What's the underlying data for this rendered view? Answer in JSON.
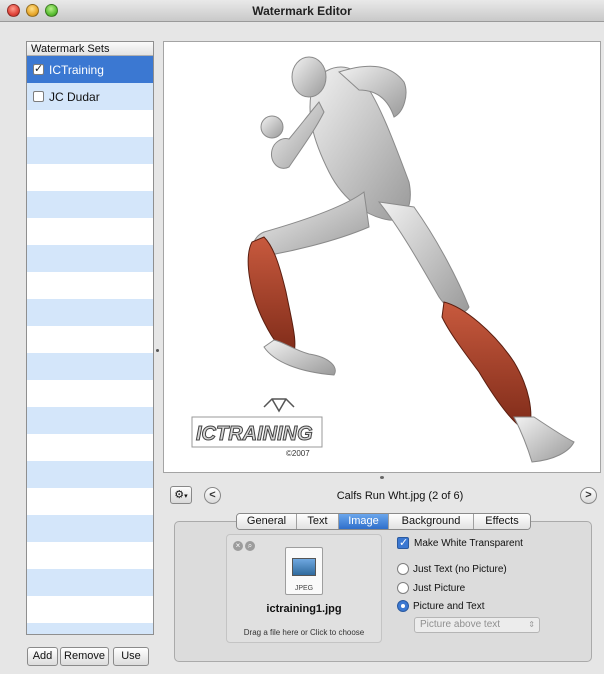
{
  "window": {
    "title": "Watermark Editor"
  },
  "sidebar": {
    "header": "Watermark Sets",
    "items": [
      {
        "label": "ICTraining",
        "checked": true,
        "selected": true
      },
      {
        "label": "JC Dudar",
        "checked": false,
        "selected": false
      }
    ]
  },
  "sidebar_buttons": {
    "add": "Add",
    "remove": "Remove",
    "use": "Use"
  },
  "preview": {
    "watermark_text": "ICTRAINING",
    "watermark_year": "©2007"
  },
  "nav": {
    "file_label": "Calfs Run Wht.jpg (2 of 6)",
    "prev_label": "<",
    "next_label": ">"
  },
  "tabs": [
    "General",
    "Text",
    "Image",
    "Background",
    "Effects"
  ],
  "active_tab": "Image",
  "image_tab": {
    "file_ext": "JPEG",
    "file_name": "ictraining1.jpg",
    "drop_hint": "Drag a file here or Click to choose",
    "make_white_transparent": "Make White Transparent",
    "radio_options": [
      "Just Text (no Picture)",
      "Just Picture",
      "Picture and Text"
    ],
    "selected_option": "Picture and Text",
    "position_select": "Picture above text"
  },
  "colors": {
    "selection": "#3b78d2",
    "row_stripe": "#d4e6fa",
    "muscle": "#b0402a"
  }
}
